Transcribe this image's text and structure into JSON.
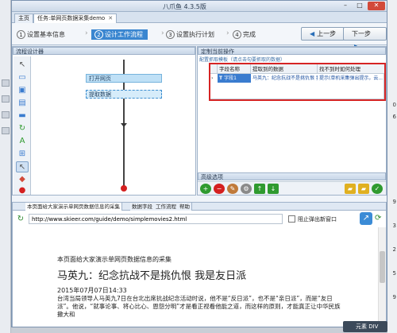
{
  "app": {
    "title": "八爪鱼 4.3.5版",
    "controls": {
      "minimize": "–",
      "maximize": "□",
      "close": "✕"
    }
  },
  "tabs": [
    {
      "label": "主页"
    },
    {
      "label": "任务:单网页数据采集demo",
      "close": "✕"
    }
  ],
  "steps": [
    {
      "num": "1",
      "label": "设置基本信息"
    },
    {
      "num": "2",
      "label": "设计工作流程"
    },
    {
      "num": "3",
      "label": "设置执行计划"
    },
    {
      "num": "4",
      "label": "完成"
    }
  ],
  "nav": {
    "prev_label": "上一步",
    "next_label": "下一步"
  },
  "designer": {
    "header": "流程设计器",
    "nodes": [
      "打开网页",
      "提取数据"
    ],
    "tools": [
      "pointer-icon",
      "open-page-icon",
      "click-icon",
      "extract-icon",
      "input-icon",
      "loop-icon",
      "if-icon",
      "select-icon",
      "move-icon",
      "switch-icon",
      "stop-icon"
    ]
  },
  "customize": {
    "header": "定制当前操作",
    "subheader": "配置抓取模板（请点击勾要抓取的数据）",
    "columns": [
      "",
      "字段名称",
      "提取到的数据",
      "找不到时如何处理"
    ],
    "rows": [
      {
        "marker": "›",
        "name": "字段1",
        "value": "马英九：纪念抗战不是挑仇恨 我...",
        "fallback": "提示(单机采集弹出提示，云..."
      }
    ],
    "advanced_label": "高级选项"
  },
  "bottom": {
    "tabs": [
      "本页面给大家演示单网页数据信息的采集",
      "数据字段",
      "工作流程",
      "帮助"
    ],
    "url": "http://www.skieer.com/guide/demo/simplemovies2.html",
    "block_popups_label": "阻止弹出新窗口",
    "page": {
      "header": "本页面给大家演示单网页数据信息的采集",
      "title": "马英九：纪念抗战不是挑仇恨 我是友日派",
      "date": "2015年07月07日14:33",
      "body": "台湾当局领导人马英九7日在台北出席抗战纪念活动时说，他不是“反日派”，也不是“亲日派”，而是“友日派”。他说，“就事论事、将心比心、恩怨分明”才是看正视看他能之道，而这样的原则，才能真正让中华民族撒大和"
    }
  },
  "desktop_right": [
    "0",
    "6",
    "9",
    "3",
    "2",
    "5",
    "9"
  ],
  "taskbar_label": "元素 DIV"
}
